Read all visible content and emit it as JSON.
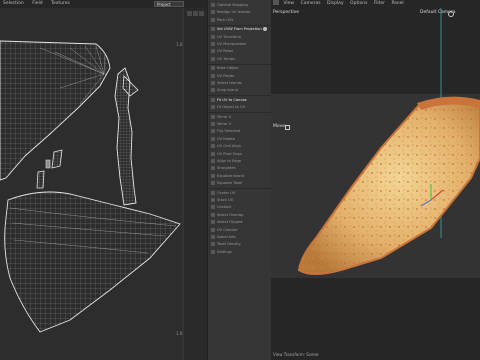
{
  "uv_menu": [
    "Selection",
    "Field",
    "Textures"
  ],
  "uv_project": "Project",
  "ruler": {
    "top_right": "1.0",
    "bottom_right": "1.0"
  },
  "tools": [
    {
      "label": "Optimal Mapping",
      "highlight": false
    },
    {
      "label": "Realign UV Islands",
      "highlight": false
    },
    {
      "label": "Pack UVs",
      "highlight": false
    },
    {
      "label": "Set UVW From Projection",
      "highlight": true,
      "badge": true
    },
    {
      "label": "UV Transform",
      "highlight": false
    },
    {
      "label": "UV Manipulation",
      "highlight": false
    },
    {
      "label": "UV Relax",
      "highlight": false
    },
    {
      "label": "UV Terrain",
      "highlight": false
    },
    {
      "label": "Bake Object",
      "highlight": false
    },
    {
      "label": "UV Peeler",
      "highlight": false
    },
    {
      "label": "Select Islands",
      "highlight": false
    },
    {
      "label": "Snap Island",
      "highlight": false
    },
    {
      "label": "Fit UV to Canvas",
      "highlight": true
    },
    {
      "label": "Fit Object to UV",
      "highlight": false
    },
    {
      "label": "Mirror U",
      "highlight": false
    },
    {
      "label": "Mirror V",
      "highlight": false
    },
    {
      "label": "Flip Selected",
      "highlight": false
    },
    {
      "label": "UV Rotate",
      "highlight": false
    },
    {
      "label": "UV Grid Align",
      "highlight": false
    },
    {
      "label": "UV Pixel Snap",
      "highlight": false
    },
    {
      "label": "Align to Edge",
      "highlight": false
    },
    {
      "label": "Straighten",
      "highlight": false
    },
    {
      "label": "Equalize Island",
      "highlight": false
    },
    {
      "label": "Equalize Texel",
      "highlight": false
    },
    {
      "label": "Center UV",
      "highlight": false
    },
    {
      "label": "Stack UV",
      "highlight": false
    },
    {
      "label": "Unstack",
      "highlight": false
    },
    {
      "label": "Select Overlap",
      "highlight": false
    },
    {
      "label": "Select Flipped",
      "highlight": false
    },
    {
      "label": "UV Checker",
      "highlight": false
    },
    {
      "label": "Island Info",
      "highlight": false
    },
    {
      "label": "Texel Density",
      "highlight": false
    },
    {
      "label": "Settings",
      "highlight": false
    }
  ],
  "vp_menu": [
    "View",
    "Cameras",
    "Display",
    "Options",
    "Filter",
    "Panel"
  ],
  "vp": {
    "mode": "Perspective",
    "camera": "Default Camera",
    "tool": "Move",
    "status": "View Transform: Scene"
  },
  "colors": {
    "accent": "#4aa4a4",
    "uv_wire": "#d8d8d8",
    "crust": "#c8743a",
    "cheese": "#e8c07a"
  }
}
